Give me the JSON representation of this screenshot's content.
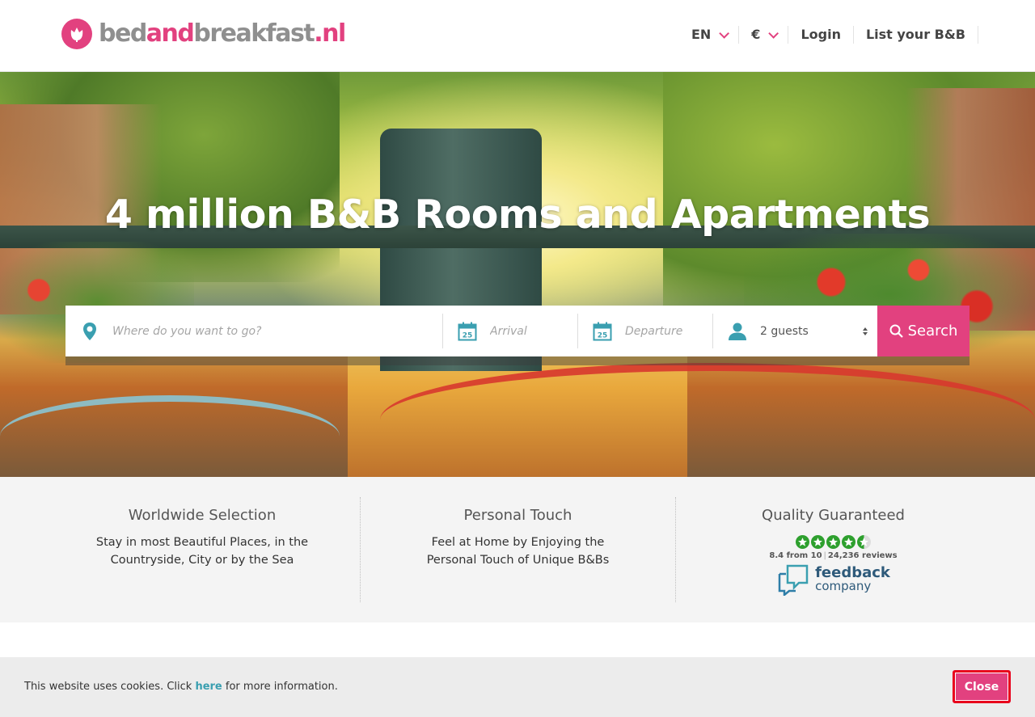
{
  "header": {
    "logo": {
      "part1": "bed",
      "part2": "and",
      "part3": "breakfast",
      "part4": ".nl"
    },
    "language_label": "EN",
    "currency_label": "€",
    "login_label": "Login",
    "list_label": "List your B&B"
  },
  "hero": {
    "title": "4 million B&B Rooms and Apartments",
    "search": {
      "where_placeholder": "Where do you want to go?",
      "arrival_placeholder": "Arrival",
      "departure_placeholder": "Departure",
      "guests_value": "2 guests",
      "calendar_day": "25",
      "search_label": "Search"
    }
  },
  "features": [
    {
      "title": "Worldwide Selection",
      "text": "Stay in most Beautiful Places, in the Countryside, City or by the Sea"
    },
    {
      "title": "Personal Touch",
      "text": "Feel at Home by Enjoying the Personal Touch of Unique B&Bs"
    },
    {
      "title": "Quality Guaranteed",
      "rating": "8.4 from 10",
      "reviews": "24,236 reviews",
      "badge_line1": "feedback",
      "badge_line2": "company"
    }
  ],
  "cookie": {
    "before": "This website uses cookies. Click ",
    "link": "here",
    "after": " for more information.",
    "close_label": "Close"
  },
  "colors": {
    "brand": "#e2417f",
    "teal": "#3a9fb0",
    "star_green": "#2ea02e"
  }
}
